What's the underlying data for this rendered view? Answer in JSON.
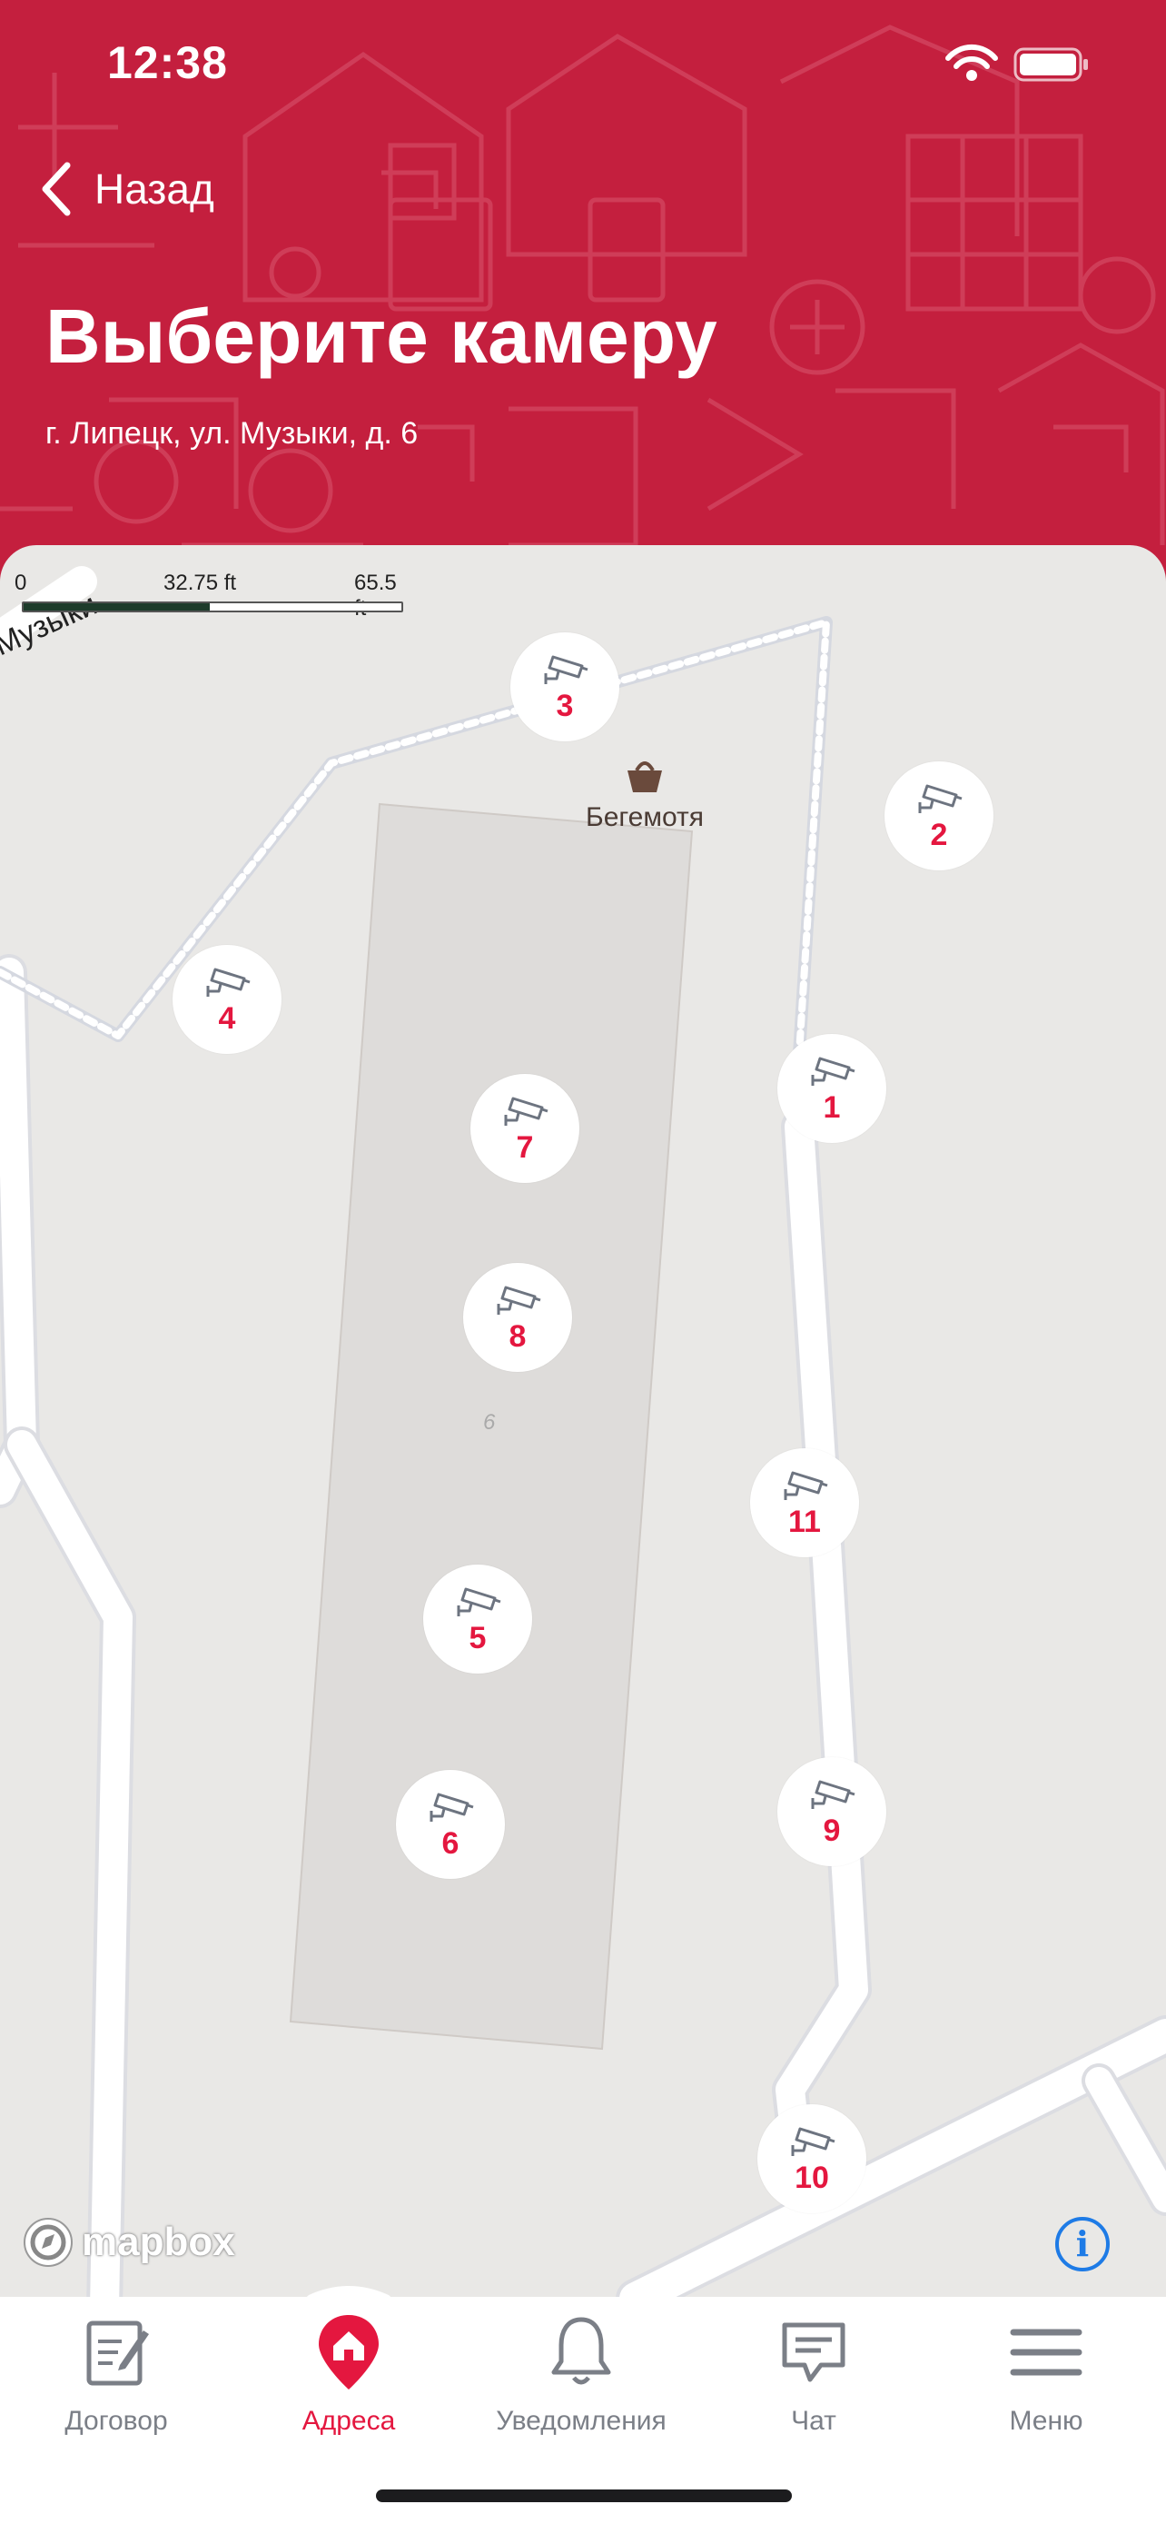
{
  "status_bar": {
    "time": "12:38"
  },
  "header": {
    "back_label": "Назад",
    "title": "Выберите камеру",
    "address": "г. Липецк, ул. Музыки, д. 6"
  },
  "map": {
    "scale": {
      "zero": "0",
      "mid": "32.75 ft",
      "max": "65.5 ft"
    },
    "street_label": "Музыки",
    "poi_name": "Бегемотя",
    "building_number": "6",
    "attribution": "mapbox",
    "info_symbol": "i",
    "cameras": [
      {
        "number": "1"
      },
      {
        "number": "2"
      },
      {
        "number": "3"
      },
      {
        "number": "4"
      },
      {
        "number": "5"
      },
      {
        "number": "6"
      },
      {
        "number": "7"
      },
      {
        "number": "8"
      },
      {
        "number": "9"
      },
      {
        "number": "10"
      },
      {
        "number": "11"
      }
    ]
  },
  "tabbar": {
    "active": "Адреса",
    "items": [
      {
        "label": "Договор",
        "icon": "contract-icon"
      },
      {
        "label": "Адреса",
        "icon": "home-pin-icon"
      },
      {
        "label": "Уведомления",
        "icon": "bell-icon"
      },
      {
        "label": "Чат",
        "icon": "chat-icon"
      },
      {
        "label": "Меню",
        "icon": "menu-icon"
      }
    ]
  },
  "colors": {
    "header_bg": "#c41f3e",
    "accent": "#e4173f",
    "map_bg": "#e9e8e6",
    "inactive_tab": "#7b7f87",
    "info_blue": "#1e7be6"
  }
}
